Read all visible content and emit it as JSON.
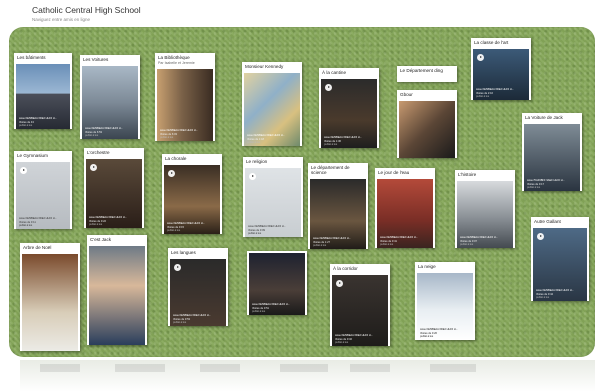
{
  "header": {
    "title": "Catholic Central High School",
    "subtitle": "Naviguez entre amis en ligne"
  },
  "cards": [
    {
      "title": "Les bâtiments",
      "meta": [
        "www.1929BEAA 6DE2 HHOI H...",
        "Visites de 43",
        "publié à les"
      ]
    },
    {
      "title": "Les Voitures",
      "meta": [
        "www.1929BEAA 6DE2 HHOI H...",
        "Visites de 6:53",
        "publié à les"
      ]
    },
    {
      "title": "La Bibliothèque",
      "subtitle": "Par Isabelle et Jeremie",
      "meta": [
        "www.1929BEAA 6DE2 HHOI H...",
        "Visites de 6:03",
        "publié à les"
      ]
    },
    {
      "title": "Monsieur Kennedy",
      "meta": [
        "www.1929BEAA 6DE2 HHOI H...",
        "Visites de 1:18",
        "publié à les"
      ]
    },
    {
      "title": "À la cantine",
      "meta": [
        "www.1929BEAA 6DE2 HHOI H...",
        "Visites de 1:36",
        "publié à les"
      ]
    },
    {
      "title": "Le Département ding",
      "meta": []
    },
    {
      "title": "Gbour",
      "meta": []
    },
    {
      "title": "La classe de l'art",
      "meta": [
        "www.1929BEAA 6DE2 HHOI H...",
        "Visites de 2:16",
        "publié à les"
      ]
    },
    {
      "title": "La Voiture de Jack",
      "meta": [
        "www.7FA49BFF 9AEF HHOI H...",
        "Visites de 0:17",
        "publié à les"
      ]
    },
    {
      "title": "Le Gymnasium",
      "meta": [
        "www.1929BEAA 6DE2 HHOI H...",
        "Visites de 0:11",
        "publié à les"
      ]
    },
    {
      "title": "L'orchestre",
      "meta": [
        "www.1929BEAA 6DE2 HHOI H...",
        "Visites de 0:22",
        "publié à les"
      ]
    },
    {
      "title": "La chorale",
      "meta": [
        "www.1929BEAA 6DE2 HHOI H...",
        "Visites de 0:15",
        "publié à les"
      ]
    },
    {
      "title": "Le religion",
      "meta": [
        "www.1929BEAA 6DE2 HHOI H...",
        "Visites de 0:09",
        "publié à les"
      ]
    },
    {
      "title": "Le département de science",
      "meta": [
        "www.1929BEAA 6DE2 HHOI H...",
        "Visites de 1:27",
        "publié à les"
      ]
    },
    {
      "title": "Le jour de l'eau",
      "meta": [
        "www.1929BEAA 6DE2 HHOI H...",
        "Visites de 0:41",
        "publié à les"
      ]
    },
    {
      "title": "L'histoire",
      "meta": [
        "www.1929BEAA 6DE2 HHOI H...",
        "Visites de 0:07",
        "publié à les"
      ]
    },
    {
      "title": "Autre Gallant",
      "meta": [
        "www.1929BEAA 6DE2 HHOI H...",
        "Visites de 0:44",
        "publié à les"
      ]
    },
    {
      "title": "Arbre de Noël",
      "meta": []
    },
    {
      "title": "C'est Jack",
      "meta": []
    },
    {
      "title": "Les langues",
      "meta": [
        "www.1929BEAA 6DE2 HHOI H...",
        "Visites de 0:53",
        "publié à les"
      ]
    },
    {
      "title": "",
      "meta": [
        "www.1929BEAA 6DE2 HHOI H...",
        "Visites de 0:51",
        "publié à les"
      ]
    },
    {
      "title": "À la corridor",
      "meta": [
        "www.1929BEAA 6DE2 HHOI H...",
        "Visites de 0:32",
        "publié à les"
      ]
    },
    {
      "title": "La neige",
      "meta": [
        "www.1929BEAA 6DE2 HHOI H...",
        "Visites de 0:26",
        "publié à les"
      ]
    }
  ],
  "icons": {
    "play": "play-icon"
  },
  "colors": {
    "board": "#86a85a",
    "card": "#ffffff"
  }
}
